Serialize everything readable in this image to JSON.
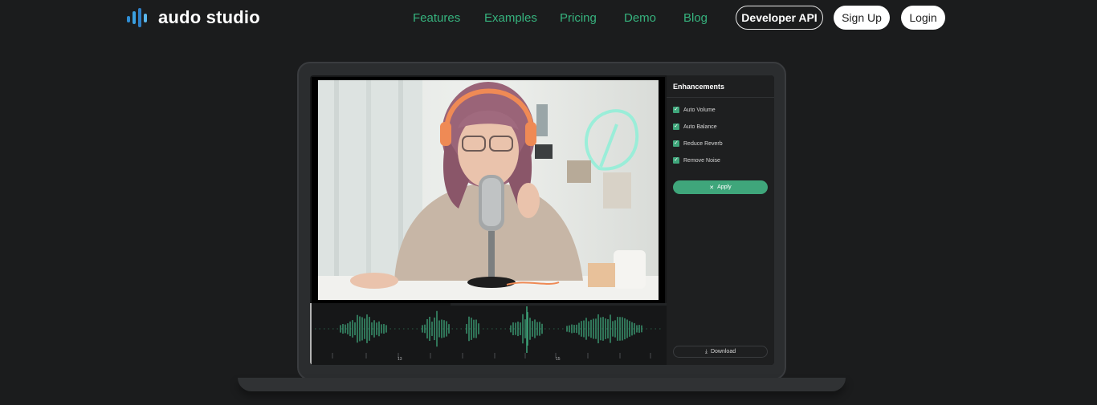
{
  "brand": {
    "name": "audo studio"
  },
  "nav": {
    "links": [
      "Features",
      "Examples",
      "Pricing",
      "Demo",
      "Blog"
    ],
    "developer_api": "Developer API",
    "sign_up": "Sign Up",
    "login": "Login"
  },
  "editor": {
    "panel_title": "Enhancements",
    "options": [
      "Auto Volume",
      "Auto Balance",
      "Reduce Reverb",
      "Remove Noise"
    ],
    "apply_label": "Apply",
    "download_label": "Download",
    "timeline_labels": [
      "13",
      "15"
    ]
  },
  "colors": {
    "accent": "#36b37e",
    "waveform": "#3fa67b",
    "background": "#1b1c1d"
  }
}
